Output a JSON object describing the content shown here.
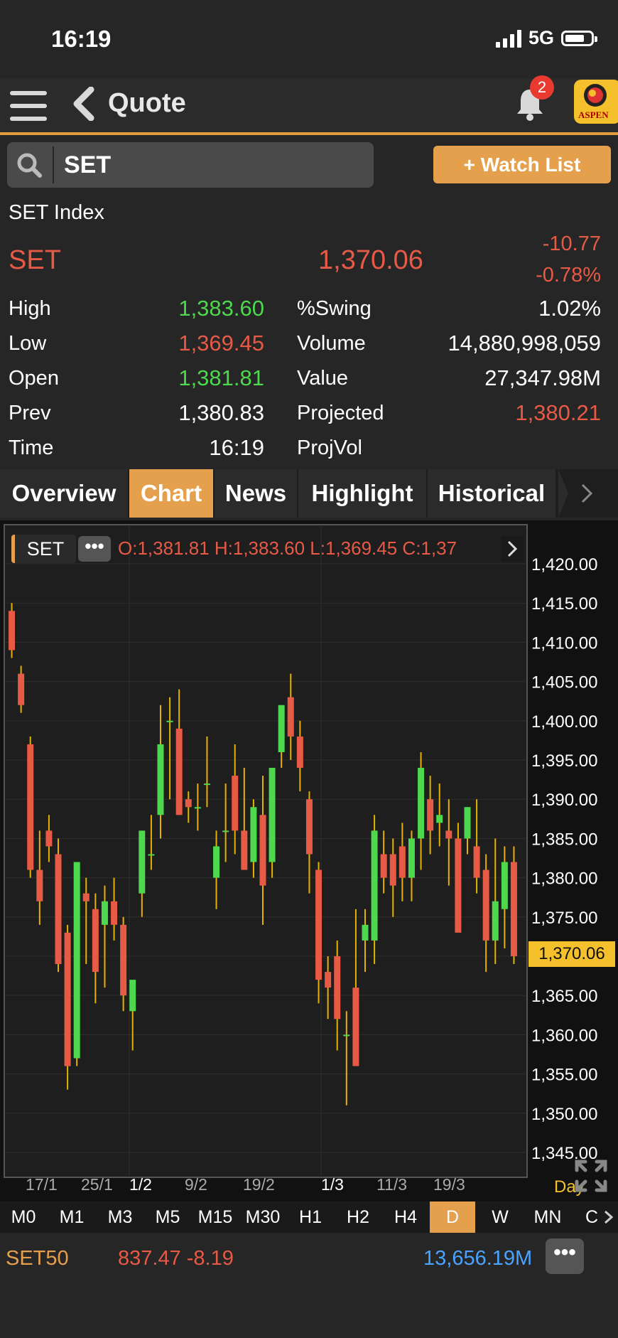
{
  "status_bar": {
    "time": "16:19",
    "network": "5G"
  },
  "header": {
    "title": "Quote",
    "notification_count": "2",
    "logo_text": "ASPEN"
  },
  "search": {
    "value": "SET"
  },
  "watchlist_button": "+ Watch List",
  "quote": {
    "index_name": "SET Index",
    "symbol": "SET",
    "last": "1,370.06",
    "change": "-10.77",
    "change_pct": "-0.78%",
    "left_stats": [
      {
        "label": "High",
        "value": "1,383.60",
        "color": "green"
      },
      {
        "label": "Low",
        "value": "1,369.45",
        "color": "red"
      },
      {
        "label": "Open",
        "value": "1,381.81",
        "color": "green"
      },
      {
        "label": "Prev",
        "value": "1,380.83",
        "color": "white"
      },
      {
        "label": "Time",
        "value": "16:19",
        "color": "white"
      }
    ],
    "right_stats": [
      {
        "label": "%Swing",
        "value": "1.02%",
        "color": "white"
      },
      {
        "label": "Volume",
        "value": "14,880,998,059",
        "color": "white"
      },
      {
        "label": "Value",
        "value": "27,347.98M",
        "color": "white"
      },
      {
        "label": "Projected",
        "value": "1,380.21",
        "color": "red"
      },
      {
        "label": "ProjVol",
        "value": "",
        "color": "white"
      }
    ]
  },
  "tabs": [
    "Overview",
    "Chart",
    "News",
    "Highlight",
    "Historical"
  ],
  "active_tab": "Chart",
  "chart": {
    "symbol": "SET",
    "ohlc_text": "O:1,381.81  H:1,383.60  L:1,369.45  C:1,37",
    "current_price_tag": "1,370.06",
    "period_label": "Day"
  },
  "chart_data": {
    "type": "candlestick",
    "y_ticks": [
      "1,420.00",
      "1,415.00",
      "1,410.00",
      "1,405.00",
      "1,400.00",
      "1,395.00",
      "1,390.00",
      "1,385.00",
      "1,380.00",
      "1,375.00",
      "1,370.00",
      "1,365.00",
      "1,360.00",
      "1,355.00",
      "1,350.00",
      "1,345.00"
    ],
    "ylim": [
      1344,
      1421
    ],
    "x_labels": [
      "17/1",
      "25/1",
      "1/2",
      "9/2",
      "19/2",
      "1/3",
      "11/3",
      "19/3"
    ],
    "candles": [
      {
        "o": 1414,
        "h": 1415,
        "l": 1408,
        "c": 1409
      },
      {
        "o": 1406,
        "h": 1407,
        "l": 1401,
        "c": 1402
      },
      {
        "o": 1397,
        "h": 1398,
        "l": 1380,
        "c": 1381
      },
      {
        "o": 1381,
        "h": 1386,
        "l": 1374,
        "c": 1377
      },
      {
        "o": 1386,
        "h": 1388,
        "l": 1382,
        "c": 1384
      },
      {
        "o": 1383,
        "h": 1385,
        "l": 1368,
        "c": 1369
      },
      {
        "o": 1373,
        "h": 1374,
        "l": 1353,
        "c": 1356
      },
      {
        "o": 1357,
        "h": 1382,
        "l": 1356,
        "c": 1382
      },
      {
        "o": 1378,
        "h": 1380,
        "l": 1369,
        "c": 1377
      },
      {
        "o": 1376,
        "h": 1378,
        "l": 1364,
        "c": 1368
      },
      {
        "o": 1374,
        "h": 1379,
        "l": 1366,
        "c": 1377
      },
      {
        "o": 1377,
        "h": 1380,
        "l": 1372,
        "c": 1374
      },
      {
        "o": 1374,
        "h": 1375,
        "l": 1363,
        "c": 1365
      },
      {
        "o": 1363,
        "h": 1366,
        "l": 1358,
        "c": 1367
      },
      {
        "o": 1378,
        "h": 1386,
        "l": 1375,
        "c": 1386
      },
      {
        "o": 1383,
        "h": 1388,
        "l": 1381,
        "c": 1383
      },
      {
        "o": 1388,
        "h": 1402,
        "l": 1385,
        "c": 1397
      },
      {
        "o": 1400,
        "h": 1403,
        "l": 1390,
        "c": 1400
      },
      {
        "o": 1399,
        "h": 1404,
        "l": 1388,
        "c": 1388
      },
      {
        "o": 1390,
        "h": 1391,
        "l": 1387,
        "c": 1389
      },
      {
        "o": 1389,
        "h": 1392,
        "l": 1386,
        "c": 1389
      },
      {
        "o": 1392,
        "h": 1398,
        "l": 1389,
        "c": 1392
      },
      {
        "o": 1380,
        "h": 1386,
        "l": 1376,
        "c": 1384
      },
      {
        "o": 1386,
        "h": 1392,
        "l": 1382,
        "c": 1386
      },
      {
        "o": 1393,
        "h": 1397,
        "l": 1383,
        "c": 1386
      },
      {
        "o": 1386,
        "h": 1394,
        "l": 1384,
        "c": 1381
      },
      {
        "o": 1382,
        "h": 1390,
        "l": 1380,
        "c": 1389
      },
      {
        "o": 1388,
        "h": 1393,
        "l": 1374,
        "c": 1379
      },
      {
        "o": 1382,
        "h": 1394,
        "l": 1380,
        "c": 1394
      },
      {
        "o": 1396,
        "h": 1400,
        "l": 1394,
        "c": 1402
      },
      {
        "o": 1403,
        "h": 1406,
        "l": 1395,
        "c": 1398
      },
      {
        "o": 1398,
        "h": 1400,
        "l": 1391,
        "c": 1394
      },
      {
        "o": 1390,
        "h": 1391,
        "l": 1378,
        "c": 1383
      },
      {
        "o": 1381,
        "h": 1382,
        "l": 1364,
        "c": 1367
      },
      {
        "o": 1368,
        "h": 1370,
        "l": 1362,
        "c": 1366
      },
      {
        "o": 1370,
        "h": 1372,
        "l": 1358,
        "c": 1362
      },
      {
        "o": 1360,
        "h": 1363,
        "l": 1351,
        "c": 1360
      },
      {
        "o": 1366,
        "h": 1376,
        "l": 1356,
        "c": 1356
      },
      {
        "o": 1372,
        "h": 1376,
        "l": 1368,
        "c": 1374
      },
      {
        "o": 1372,
        "h": 1388,
        "l": 1369,
        "c": 1386
      },
      {
        "o": 1383,
        "h": 1386,
        "l": 1378,
        "c": 1380
      },
      {
        "o": 1383,
        "h": 1385,
        "l": 1375,
        "c": 1379
      },
      {
        "o": 1384,
        "h": 1387,
        "l": 1377,
        "c": 1380
      },
      {
        "o": 1380,
        "h": 1386,
        "l": 1377,
        "c": 1385
      },
      {
        "o": 1385,
        "h": 1396,
        "l": 1381,
        "c": 1394
      },
      {
        "o": 1390,
        "h": 1393,
        "l": 1383,
        "c": 1386
      },
      {
        "o": 1387,
        "h": 1392,
        "l": 1384,
        "c": 1388
      },
      {
        "o": 1386,
        "h": 1390,
        "l": 1379,
        "c": 1385
      },
      {
        "o": 1385,
        "h": 1387,
        "l": 1374,
        "c": 1373
      },
      {
        "o": 1385,
        "h": 1389,
        "l": 1383,
        "c": 1389
      },
      {
        "o": 1384,
        "h": 1390,
        "l": 1378,
        "c": 1380
      },
      {
        "o": 1381,
        "h": 1383,
        "l": 1368,
        "c": 1372
      },
      {
        "o": 1372,
        "h": 1385,
        "l": 1369,
        "c": 1377
      },
      {
        "o": 1376,
        "h": 1384,
        "l": 1371,
        "c": 1382
      },
      {
        "o": 1382,
        "h": 1384,
        "l": 1369,
        "c": 1370
      }
    ]
  },
  "timeframes": [
    "M0",
    "M1",
    "M3",
    "M5",
    "M15",
    "M30",
    "H1",
    "H2",
    "H4",
    "D",
    "W",
    "MN",
    "C"
  ],
  "active_timeframe": "D",
  "ticker": {
    "name": "SET50",
    "price_change": "837.47 -8.19",
    "value": "13,656.19M"
  },
  "colors": {
    "up": "#4ed84e",
    "down": "#e65a46",
    "accent": "#e5a04d",
    "highlight": "#f4c02c"
  }
}
